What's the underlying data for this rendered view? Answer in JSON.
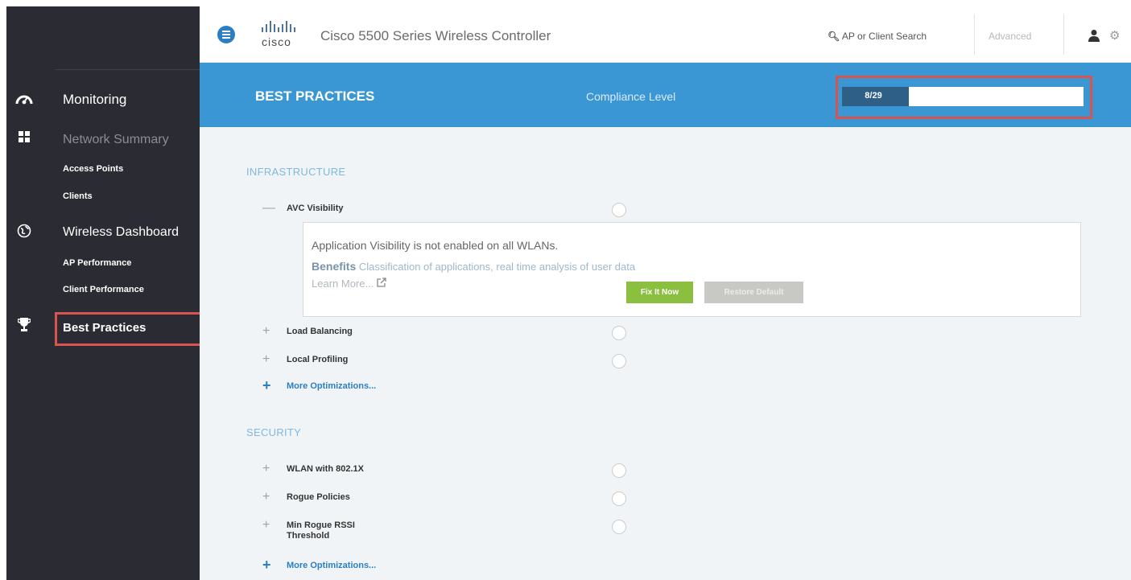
{
  "header": {
    "brand": "cisco",
    "app_title": "Cisco 5500 Series Wireless Controller",
    "search_placeholder": "AP or Client Search",
    "advanced_label": "Advanced",
    "icons": [
      "menu-icon",
      "search-icon",
      "user-icon",
      "gear-icon"
    ]
  },
  "sidebar": {
    "sections": [
      {
        "label": "Monitoring",
        "icon": "dashboard-icon"
      },
      {
        "label": "Wireless Dashboard",
        "icon": "globe-icon"
      },
      {
        "label": "Best Practices",
        "icon": "trophy-icon",
        "active": true
      }
    ],
    "monitoring_items": [
      "Network Summary",
      "Access Points",
      "Clients"
    ],
    "wireless_items": [
      "AP Performance",
      "Client Performance"
    ],
    "network_summary_icon": "grid-icon"
  },
  "band": {
    "title": "BEST PRACTICES",
    "compliance_label": "Compliance Level",
    "progress_text": "8/29",
    "progress_fraction": 0.276
  },
  "infrastructure": {
    "heading": "INFRASTRUCTURE",
    "items": [
      {
        "label": "AVC Visibility",
        "expanded": true
      },
      {
        "label": "Load Balancing",
        "expanded": false
      },
      {
        "label": "Local Profiling",
        "expanded": false
      }
    ],
    "more_label": "More Optimizations...",
    "detail": {
      "message": "Application Visibility is not enabled on all WLANs.",
      "benefits_label": "Benefits",
      "benefits_text": "Classification of applications, real time analysis of user data",
      "learn_more": "Learn More...",
      "fix_button": "Fix It Now",
      "restore_button": "Restore Default"
    }
  },
  "security": {
    "heading": "SECURITY",
    "items": [
      {
        "label": "WLAN with 802.1X"
      },
      {
        "label": "Rogue Policies"
      },
      {
        "label": "Min Rogue RSSI Threshold"
      }
    ],
    "more_label": "More Optimizations..."
  },
  "colors": {
    "sidebar_bg": "#2b2c33",
    "band_bg": "#3b97d3",
    "highlight_red": "#d9534f",
    "fix_green": "#8bbf3f",
    "accent_blue": "#2a7fc4"
  }
}
